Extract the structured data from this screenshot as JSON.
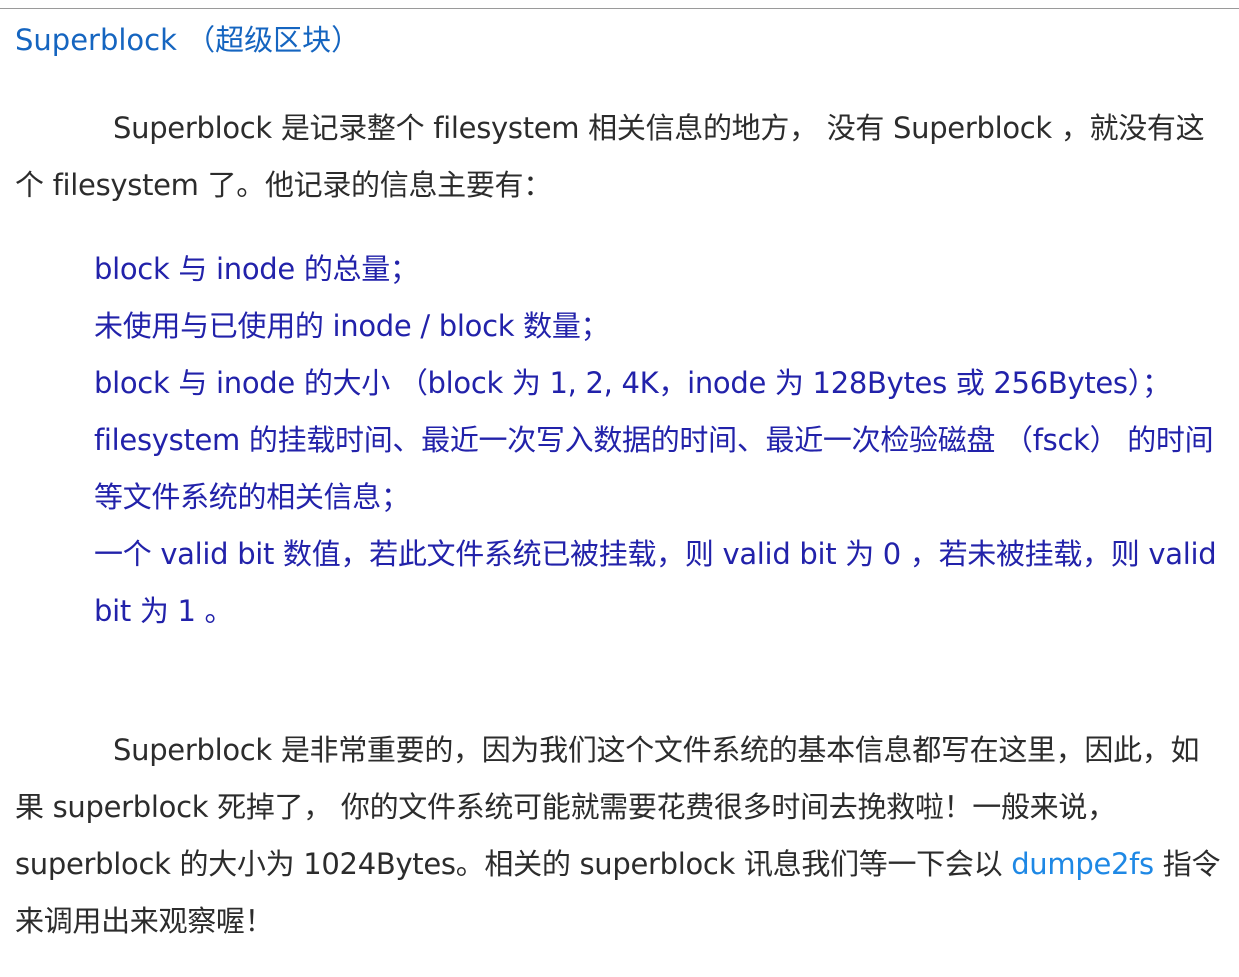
{
  "heading": "Superblock （超级区块）",
  "paragraph1": "Superblock 是记录整个 filesystem 相关信息的地方， 没有 Superblock ，就没有这个 filesystem 了。他记录的信息主要有：",
  "list_items": [
    "block 与 inode 的总量；",
    "未使用与已使用的 inode / block 数量；",
    "block 与 inode 的大小 （block 为 1, 2, 4K，inode 为 128Bytes 或 256Bytes）；",
    "filesystem 的挂载时间、最近一次写入数据的时间、最近一次检验磁盘 （fsck） 的时间等文件系统的相关信息；",
    "一个 valid bit 数值，若此文件系统已被挂载，则 valid bit 为 0 ，若未被挂载，则 valid bit 为 1 。"
  ],
  "paragraph2": {
    "text": "Superblock 是非常重要的，因为我们这个文件系统的基本信息都写在这里，因此，如果 superblock 死掉了， 你的文件系统可能就需要花费很多时间去挽救啦！一般来说， superblock 的大小为 1024Bytes。相关的 superblock 讯息我们等一下会以 ",
    "link_text": "dumpe2fs",
    "tail": " 指令来调用出来观察喔！"
  },
  "colors": {
    "heading": "#1565c0",
    "list_text": "#2222aa",
    "body_text": "#2c2c2c",
    "link": "#1e88e5"
  }
}
